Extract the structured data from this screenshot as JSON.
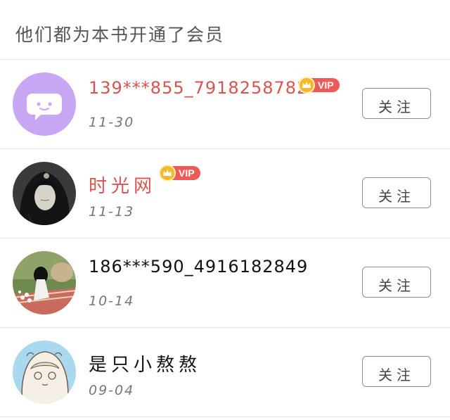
{
  "header": {
    "title": "他们都为本书开通了会员"
  },
  "vip_label": "VIP",
  "colors": {
    "vip_name": "#d9534f",
    "vip_badge": "#ec5b57",
    "crown": "#f5b82a"
  },
  "members": [
    {
      "name": "139***855_7918258782",
      "date": "11-30",
      "is_vip": true,
      "avatar": "chat-bubble",
      "follow_label": "关注"
    },
    {
      "name": "时光网",
      "date": "11-13",
      "is_vip": true,
      "avatar": "dark-hair-portrait",
      "follow_label": "关注"
    },
    {
      "name": "186***590_4916182849",
      "date": "10-14",
      "is_vip": false,
      "avatar": "girl-reading-flowers",
      "follow_label": "关注"
    },
    {
      "name": "是只小熬熬",
      "date": "09-04",
      "is_vip": false,
      "avatar": "sketch-girl",
      "follow_label": "关注"
    }
  ]
}
